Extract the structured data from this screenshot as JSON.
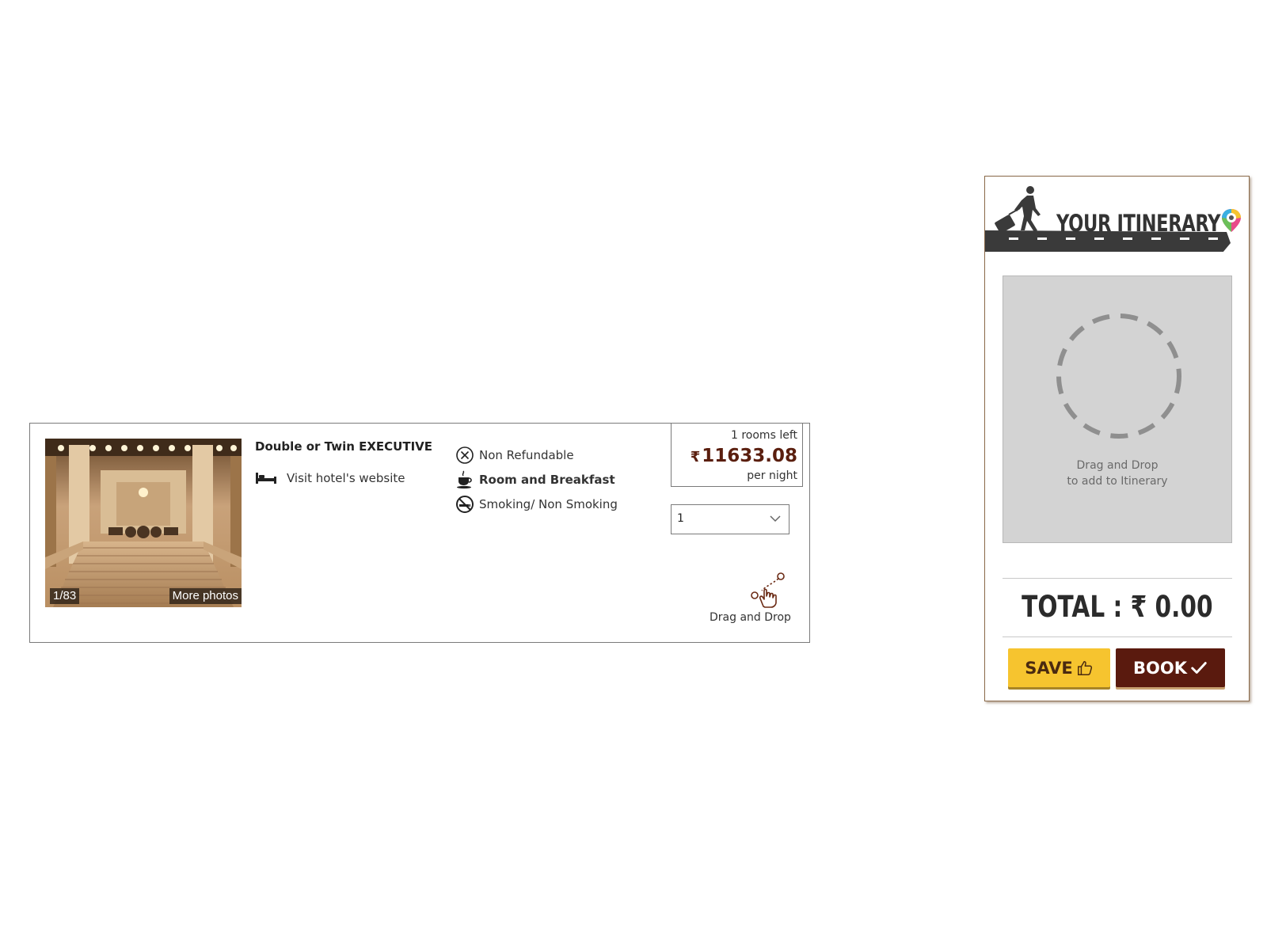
{
  "room": {
    "name": "Double or Twin EXECUTIVE",
    "website_link": "Visit hotel's website",
    "photo": {
      "counter": "1/83",
      "more_photos": "More photos"
    },
    "features": {
      "refund": "Non Refundable",
      "meal": "Room and Breakfast",
      "smoking": "Smoking/ Non Smoking"
    },
    "price": {
      "rooms_left": "1 rooms left",
      "currency": "₹",
      "amount": "11633.08",
      "per": "per night"
    },
    "quantity_select": {
      "selected": "1"
    },
    "drag_label": "Drag and Drop"
  },
  "itinerary": {
    "title": "YOUR ITINERARY",
    "drop_hint_line1": "Drag and Drop",
    "drop_hint_line2": "to add to Itinerary",
    "total_label": "TOTAL : ₹ 0.00",
    "save_label": "SAVE",
    "book_label": "BOOK"
  },
  "colors": {
    "price": "#5a1e0e",
    "save_button": "#f6c42f",
    "book_button": "#5a1a0e",
    "drop_zone": "#d3d3d3"
  },
  "icons": {
    "refund": "x-circle-icon",
    "meal": "coffee-cup-icon",
    "smoking": "no-smoking-icon",
    "bed": "bed-icon",
    "drag": "drag-hand-icon",
    "save": "thumbs-up-icon",
    "book": "checkmark-icon"
  }
}
